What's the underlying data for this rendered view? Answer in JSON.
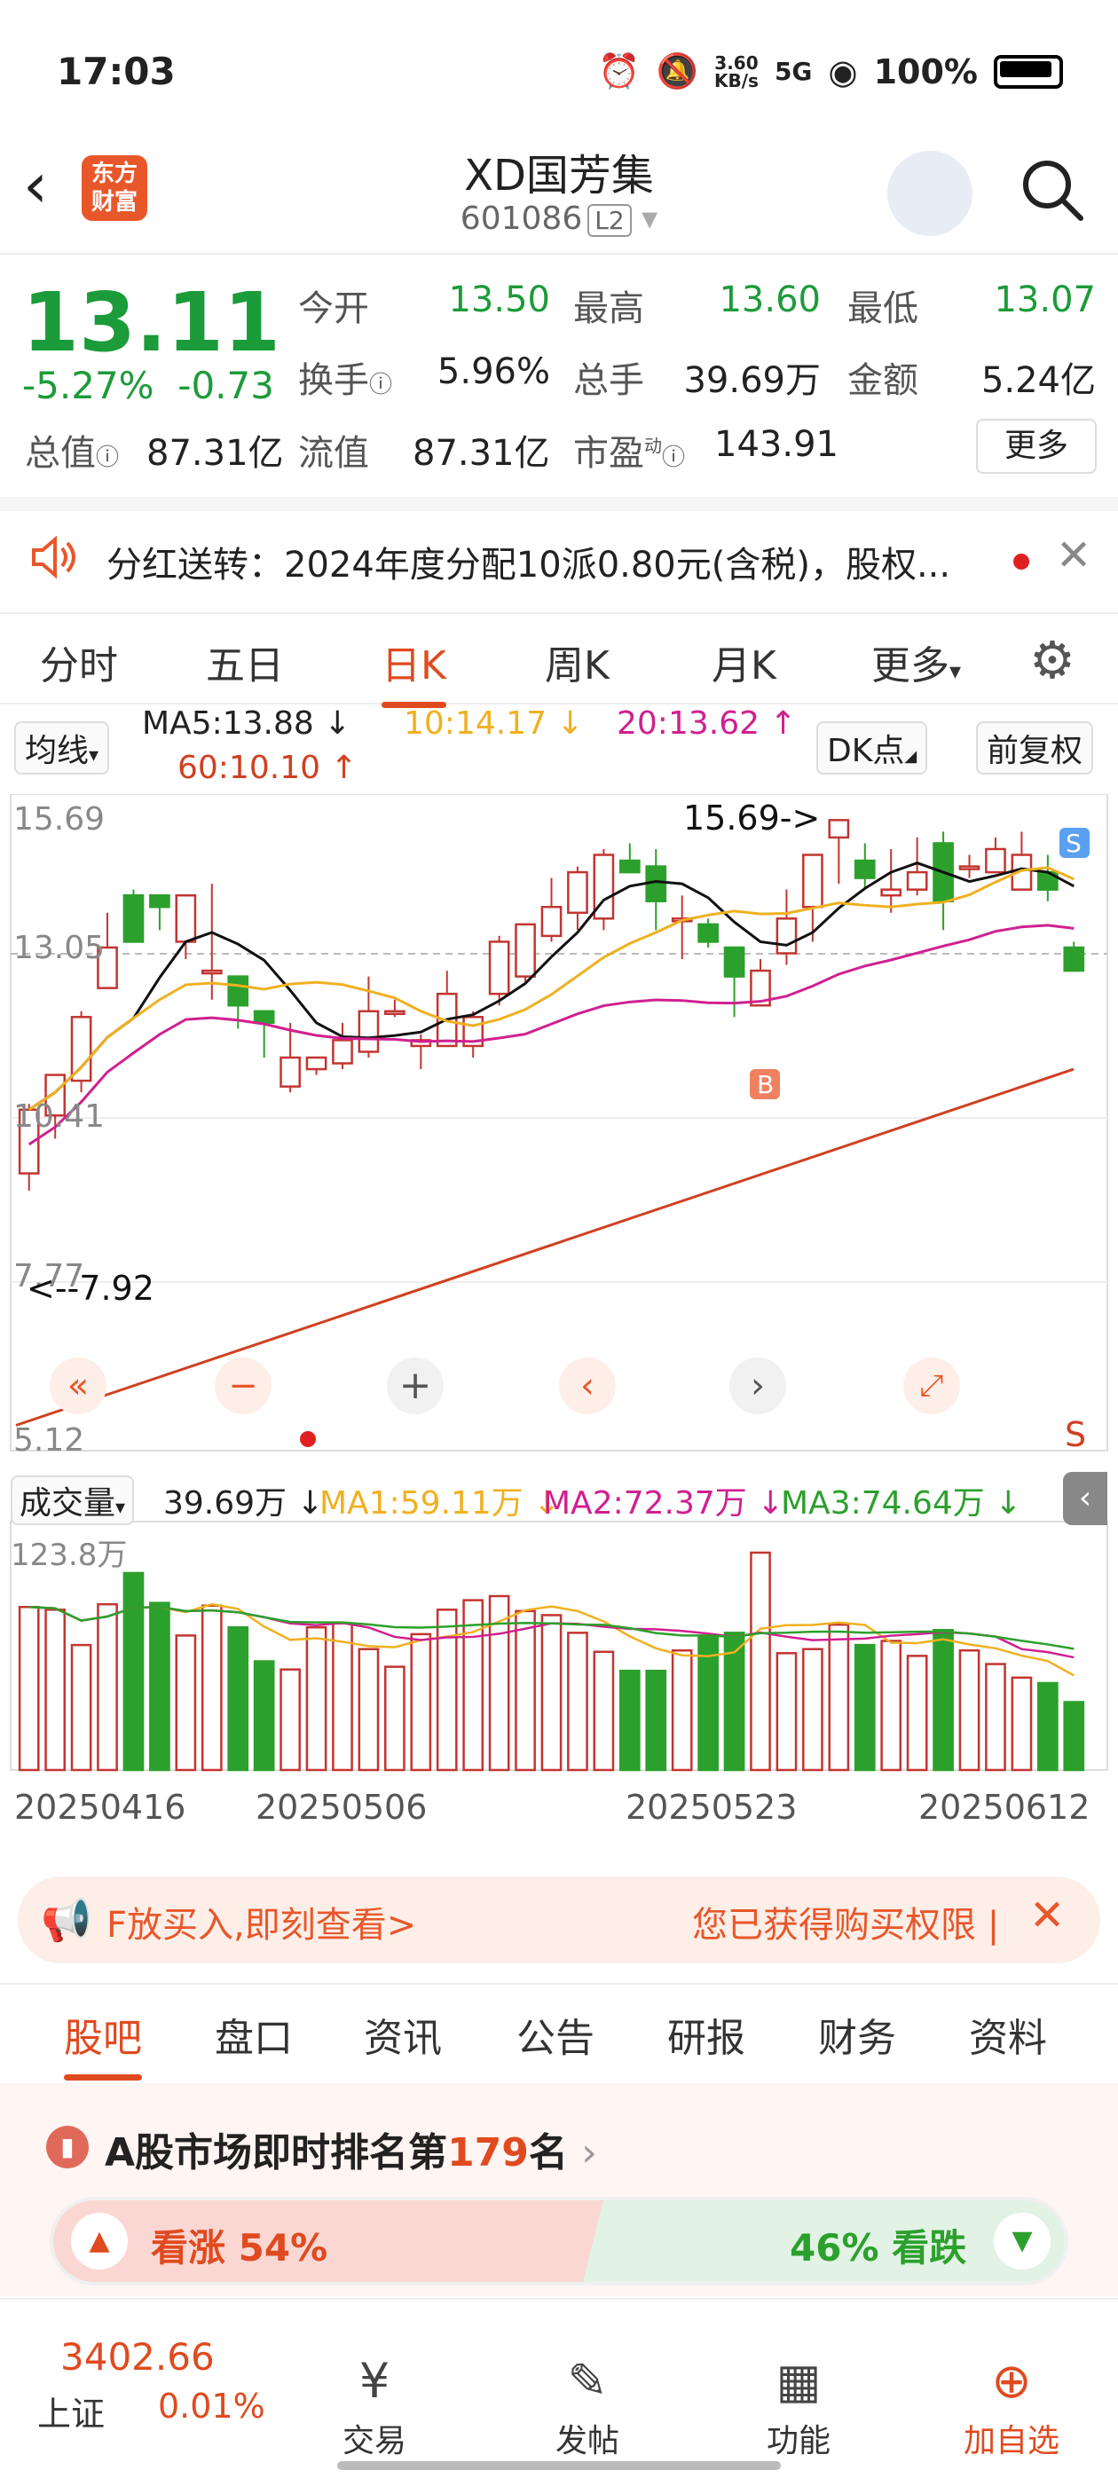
{
  "status_bar": {
    "time": "17:03",
    "speed": "3.60\nKB/s",
    "signal": "5G",
    "battery": "100%"
  },
  "header": {
    "logo_text": "东方\n财富",
    "title": "XD国芳集",
    "code": "601086",
    "level": "L2"
  },
  "quote": {
    "price": "13.11",
    "change_pct": "-5.27%",
    "change": "-0.73",
    "open_label": "今开",
    "open": "13.50",
    "high_label": "最高",
    "high": "13.60",
    "low_label": "最低",
    "low": "13.07",
    "turnover_label": "换手",
    "turnover": "5.96%",
    "volume_label": "总手",
    "volume": "39.69万",
    "amount_label": "金额",
    "amount": "5.24亿",
    "mcap_label": "总值",
    "mcap": "87.31亿",
    "float_label": "流值",
    "float": "87.31亿",
    "pe_label": "市盈",
    "pe_sup": "动",
    "pe": "143.91",
    "more": "更多"
  },
  "notice": {
    "text": "分红送转：2024年度分配10派0.80元(含税)，股权..."
  },
  "chart_tabs": [
    "分时",
    "五日",
    "日K",
    "周K",
    "月K",
    "更多"
  ],
  "ma_bar": {
    "avg_label": "均线",
    "ma5": "MA5:13.88 ↓",
    "ma10": "10:14.17 ↓",
    "ma20": "20:13.62 ↑",
    "ma60": "60:10.10 ↑",
    "dk": "DK点",
    "adjust": "前复权"
  },
  "chart_labels": {
    "y_top": "15.69",
    "y_mid": "13.05",
    "y_low": "10.41",
    "y_7": "7.77",
    "y_bottom": "5.12",
    "annot_high": "15.69->",
    "annot_low": "<--7.92",
    "buy": "B",
    "sell": "S",
    "sell_bottom": "S",
    "vol_label": "成交量",
    "vol_val": "39.69万 ↓",
    "vol_ma1": "MA1:59.11万 ↓",
    "vol_ma2": "MA2:72.37万 ↓",
    "vol_ma3": "MA3:74.64万 ↓",
    "vol_max": "123.8万",
    "dates": [
      "20250416",
      "20250506",
      "20250523",
      "20250612"
    ]
  },
  "chart_data": {
    "type": "candlestick",
    "ylim": [
      5.12,
      15.69
    ],
    "candles": [
      [
        9.6,
        10.7,
        9.3,
        10.8
      ],
      [
        10.6,
        11.3,
        10.2,
        11.3
      ],
      [
        11.2,
        12.3,
        11.0,
        12.4
      ],
      [
        12.8,
        13.5,
        12.8,
        14.1
      ],
      [
        14.4,
        13.6,
        13.6,
        14.5
      ],
      [
        14.4,
        14.2,
        13.8,
        14.4
      ],
      [
        13.6,
        14.4,
        13.3,
        14.4
      ],
      [
        13.1,
        13.1,
        12.6,
        14.6
      ],
      [
        13.0,
        12.5,
        12.1,
        13.0
      ],
      [
        12.4,
        12.2,
        11.6,
        12.4
      ],
      [
        11.1,
        11.6,
        11.0,
        12.2
      ],
      [
        11.4,
        11.6,
        11.3,
        11.6
      ],
      [
        11.5,
        11.9,
        11.4,
        12.2
      ],
      [
        11.7,
        12.4,
        11.6,
        13.0
      ],
      [
        12.4,
        12.4,
        12.3,
        12.6
      ],
      [
        11.8,
        11.9,
        11.4,
        12.0
      ],
      [
        11.8,
        12.7,
        11.9,
        13.1
      ],
      [
        11.8,
        12.3,
        11.6,
        12.4
      ],
      [
        12.7,
        13.6,
        12.5,
        13.7
      ],
      [
        13.0,
        13.9,
        12.9,
        13.9
      ],
      [
        13.7,
        14.2,
        13.6,
        14.7
      ],
      [
        14.1,
        14.8,
        13.8,
        14.9
      ],
      [
        14.0,
        15.1,
        13.8,
        15.2
      ],
      [
        15.0,
        14.8,
        14.8,
        15.3
      ],
      [
        14.9,
        14.3,
        13.8,
        15.2
      ],
      [
        14.0,
        14.0,
        13.3,
        14.4
      ],
      [
        13.9,
        13.6,
        13.5,
        14.0
      ],
      [
        13.5,
        13.0,
        12.3,
        13.5
      ],
      [
        12.5,
        13.1,
        12.7,
        13.3
      ],
      [
        13.4,
        14.0,
        13.2,
        14.5
      ],
      [
        14.2,
        15.1,
        13.6,
        15.1
      ],
      [
        15.4,
        15.7,
        14.6,
        15.7
      ],
      [
        15.0,
        14.7,
        14.5,
        15.3
      ],
      [
        14.4,
        14.5,
        14.1,
        15.2
      ],
      [
        14.5,
        14.8,
        14.4,
        15.4
      ],
      [
        15.3,
        14.3,
        13.8,
        15.5
      ],
      [
        14.9,
        14.9,
        14.7,
        15.1
      ],
      [
        14.8,
        15.2,
        14.9,
        15.4
      ],
      [
        14.5,
        15.1,
        14.6,
        15.5
      ],
      [
        14.8,
        14.5,
        14.3,
        15.1
      ],
      [
        13.5,
        13.1,
        13.1,
        13.6
      ]
    ],
    "volume": [
      120,
      118,
      92,
      122,
      145,
      123,
      99,
      121,
      105,
      80,
      74,
      105,
      108,
      89,
      76,
      100,
      118,
      125,
      128,
      117,
      114,
      101,
      87,
      73,
      73,
      88,
      98,
      101,
      160,
      86,
      89,
      107,
      92,
      95,
      84,
      103,
      88,
      78,
      68,
      64,
      50
    ]
  },
  "ad": {
    "left": "F放买入,即刻查看>",
    "right": "您已获得购买权限 |"
  },
  "content_tabs": [
    "股吧",
    "盘口",
    "资讯",
    "公告",
    "研报",
    "财务",
    "资料"
  ],
  "rank": {
    "text_a": "A股市场即时排名第",
    "num": "179",
    "text_b": "名",
    "up": "看涨 54%",
    "down": "46% 看跌"
  },
  "bottom": {
    "index_val": "3402.66",
    "index_name": "上证",
    "index_chg": "0.01%",
    "trade": "交易",
    "post": "发帖",
    "func": "功能",
    "add": "加自选"
  },
  "colors": {
    "up": "#c23531",
    "down": "#2ca02c",
    "accent": "#e04a1f"
  }
}
